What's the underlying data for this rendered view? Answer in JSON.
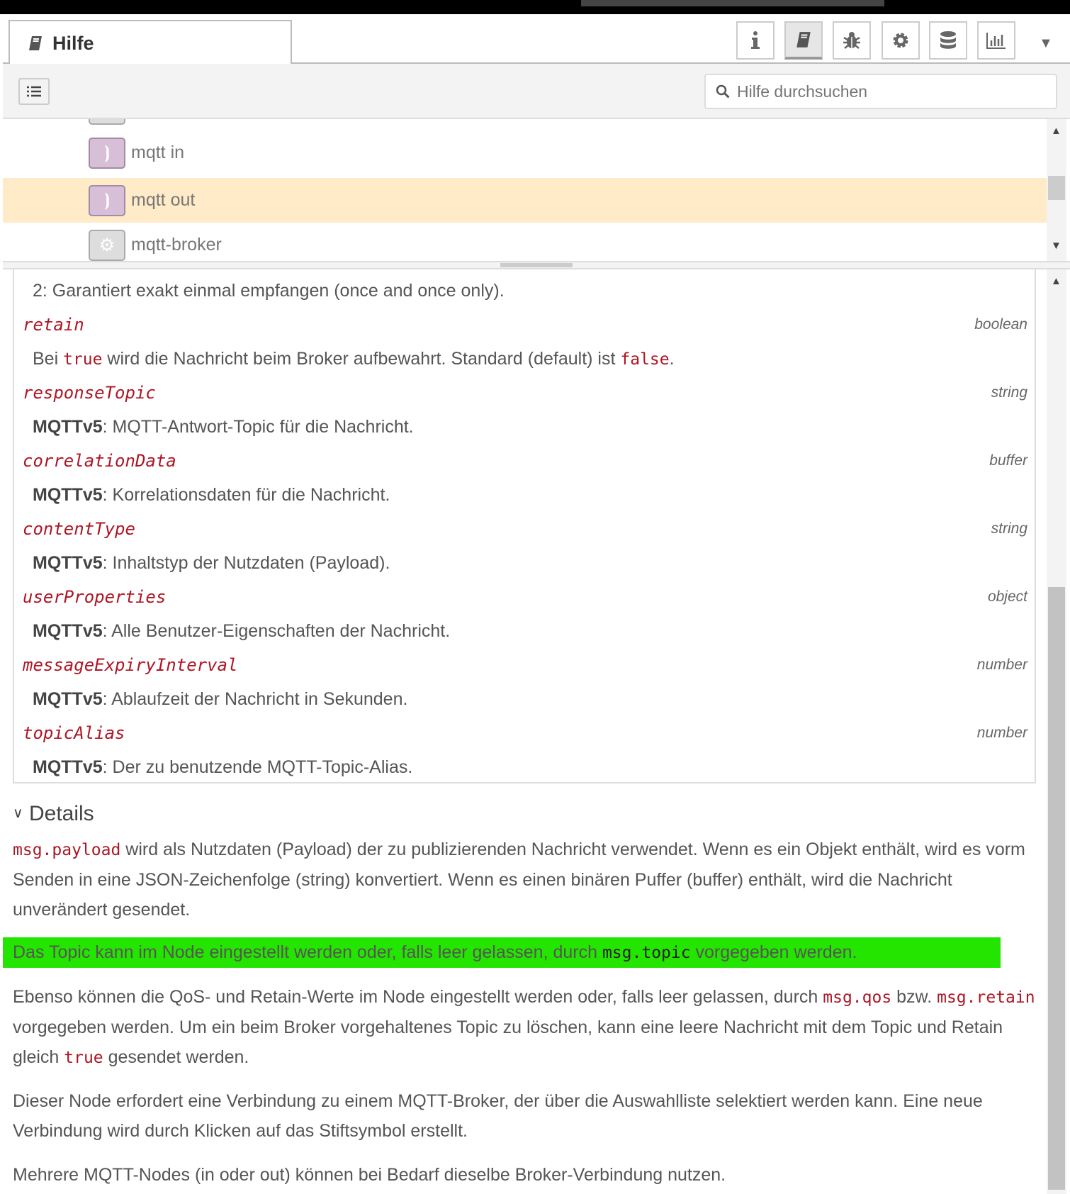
{
  "tab": {
    "title": "Hilfe",
    "icon": "book-icon"
  },
  "sidebar_buttons": [
    {
      "name": "info-icon",
      "active": false
    },
    {
      "name": "book-icon",
      "active": true
    },
    {
      "name": "bug-icon",
      "active": false
    },
    {
      "name": "gear-icon",
      "active": false
    },
    {
      "name": "database-icon",
      "active": false
    },
    {
      "name": "chart-icon",
      "active": false
    }
  ],
  "toolbar": {
    "search_placeholder": "Hilfe durchsuchen"
  },
  "nodes": [
    {
      "label": "mqtt in",
      "selected": false
    },
    {
      "label": "mqtt out",
      "selected": true
    },
    {
      "label": "mqtt-broker",
      "selected": false
    }
  ],
  "colors": {
    "selected_row": "#ffebc8",
    "code": "#AD1625",
    "highlight": "#24e500",
    "node": "#d8bfd8"
  },
  "params": {
    "qos_tail": "2: Garantiert exakt einmal empfangen (once and once only).",
    "items": [
      {
        "name": "retain",
        "type": "boolean",
        "pre": "Bei ",
        "code1": "true",
        "mid": " wird die Nachricht beim Broker aufbewahrt. Standard (default) ist ",
        "code2": "false",
        "post": "."
      },
      {
        "name": "responseTopic",
        "type": "string",
        "bold": "MQTTv5",
        "desc": ": MQTT-Antwort-Topic für die Nachricht."
      },
      {
        "name": "correlationData",
        "type": "buffer",
        "bold": "MQTTv5",
        "desc": ": Korrelationsdaten für die Nachricht."
      },
      {
        "name": "contentType",
        "type": "string",
        "bold": "MQTTv5",
        "desc": ": Inhaltstyp der Nutzdaten (Payload)."
      },
      {
        "name": "userProperties",
        "type": "object",
        "bold": "MQTTv5",
        "desc": ": Alle Benutzer-Eigenschaften der Nachricht."
      },
      {
        "name": "messageExpiryInterval",
        "type": "number",
        "bold": "MQTTv5",
        "desc": ": Ablaufzeit der Nachricht in Sekunden."
      },
      {
        "name": "topicAlias",
        "type": "number",
        "bold": "MQTTv5",
        "desc": ": Der zu benutzende MQTT-Topic-Alias."
      }
    ]
  },
  "details": {
    "heading": "Details",
    "p1": {
      "code": "msg.payload",
      "text": " wird als Nutzdaten (Payload) der zu publizierenden Nachricht verwendet. Wenn es ein Objekt enthält, wird es vorm Senden in eine JSON-Zeichenfolge (string) konvertiert. Wenn es einen binären Puffer (buffer) enthält, wird die Nachricht unverändert gesendet."
    },
    "p2": {
      "pre": "Das Topic kann im Node eingestellt werden oder, falls leer gelassen, durch ",
      "code": "msg.topic",
      "post": " vorgegeben werden."
    },
    "p3": {
      "t1": "Ebenso können die QoS- und Retain-Werte im Node eingestellt werden oder, falls leer gelassen, durch ",
      "c1": "msg.qos",
      "t2": " bzw. ",
      "c2": "msg.retain",
      "t3": " vorgegeben werden. Um ein beim Broker vorgehaltenes Topic zu löschen, kann eine leere Nachricht mit dem Topic und Retain gleich ",
      "c3": "true",
      "t4": " gesendet werden."
    },
    "p4": "Dieser Node erfordert eine Verbindung zu einem MQTT-Broker, der über die Auswahlliste selektiert werden kann. Eine neue Verbindung wird durch Klicken auf das Stiftsymbol erstellt.",
    "p5": "Mehrere MQTT-Nodes (in oder out) können bei Bedarf dieselbe Broker-Verbindung nutzen."
  }
}
